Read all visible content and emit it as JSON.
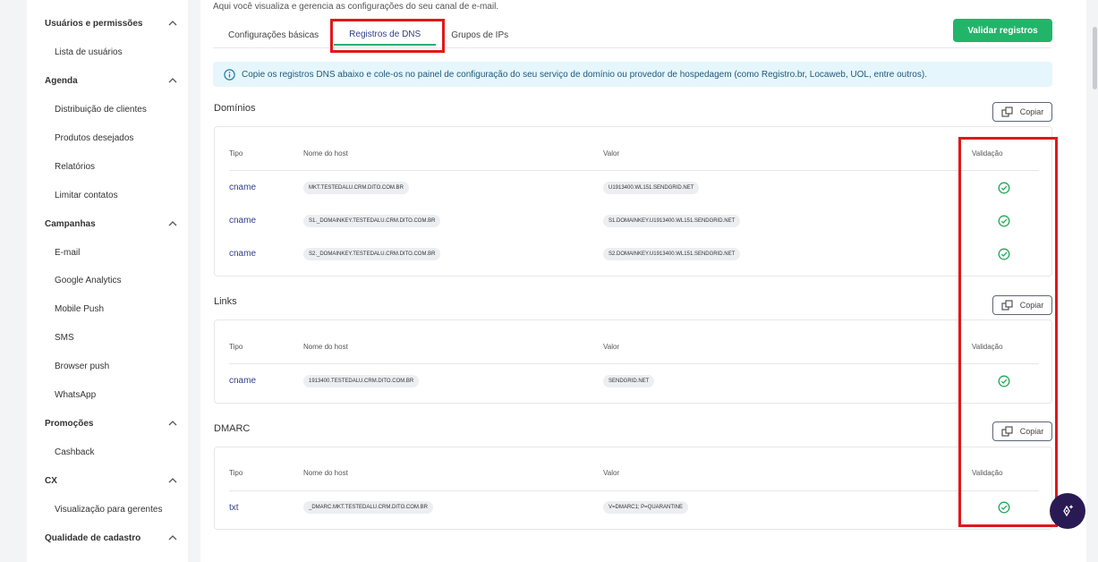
{
  "sidebar": {
    "sections": [
      {
        "title": "Usuários e permissões",
        "items": [
          "Lista de usuários"
        ]
      },
      {
        "title": "Agenda",
        "items": [
          "Distribuição de clientes",
          "Produtos desejados",
          "Relatórios",
          "Limitar contatos"
        ]
      },
      {
        "title": "Campanhas",
        "items": [
          "E-mail",
          "Google Analytics",
          "Mobile Push",
          "SMS",
          "Browser push",
          "WhatsApp"
        ]
      },
      {
        "title": "Promoções",
        "items": [
          "Cashback"
        ]
      },
      {
        "title": "CX",
        "items": [
          "Visualização para gerentes"
        ]
      },
      {
        "title": "Qualidade de cadastro",
        "items": []
      }
    ]
  },
  "header": {
    "subtitle": "Aqui você visualiza e gerencia as configurações do seu canal de e-mail.",
    "validate_label": "Validar registros"
  },
  "tabs": [
    {
      "label": "Configurações básicas",
      "active": false
    },
    {
      "label": "Registros de DNS",
      "active": true
    },
    {
      "label": "Grupos de IPs",
      "active": false
    }
  ],
  "info": {
    "text": "Copie os registros DNS abaixo e cole-os no painel de configuração do seu serviço de domínio ou provedor de hospedagem (como Registro.br, Locaweb, UOL, entre outros)."
  },
  "table_headers": {
    "type": "Tipo",
    "host": "Nome do host",
    "value": "Valor",
    "validation": "Validação"
  },
  "copy_label": "Copiar",
  "domains": {
    "title": "Domínios",
    "rows": [
      {
        "type": "cname",
        "host": "MKT.TESTEDALU.CRM.DITO.COM.BR",
        "value": "U1913400.WL151.SENDGRID.NET",
        "valid": true
      },
      {
        "type": "cname",
        "host": "S1._DOMAINKEY.TESTEDALU.CRM.DITO.COM.BR",
        "value": "S1.DOMAINKEY.U1913400.WL151.SENDGRID.NET",
        "valid": true
      },
      {
        "type": "cname",
        "host": "S2._DOMAINKEY.TESTEDALU.CRM.DITO.COM.BR",
        "value": "S2.DOMAINKEY.U1913400.WL151.SENDGRID.NET",
        "valid": true
      }
    ]
  },
  "links": {
    "title": "Links",
    "rows": [
      {
        "type": "cname",
        "host": "1913400.TESTEDALU.CRM.DITO.COM.BR",
        "value": "SENDGRID.NET",
        "valid": true
      }
    ]
  },
  "dmarc": {
    "title": "DMARC",
    "rows": [
      {
        "type": "txt",
        "host": "_DMARC.MKT.TESTEDALU.CRM.DITO.COM.BR",
        "value": "V=DMARC1; P=QUARANTINE",
        "valid": true
      }
    ]
  },
  "colors": {
    "accent_green": "#22b56a",
    "highlight_red": "#e0181b",
    "link_blue": "#2f3f8a",
    "fab_purple": "#2a1a54"
  }
}
